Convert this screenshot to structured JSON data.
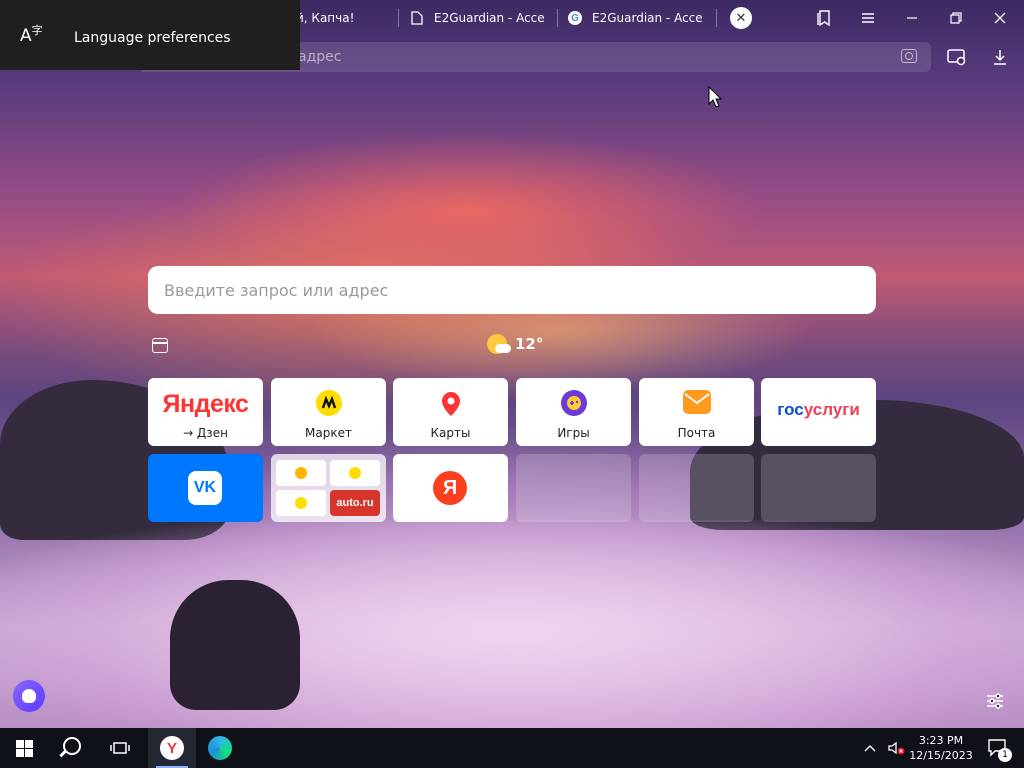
{
  "language_popup": {
    "label": "Language preferences",
    "icon": "language-icon"
  },
  "tabs": [
    {
      "title": "й, Капча!",
      "icon": "captcha-favicon"
    },
    {
      "title": "E2Guardian - Acce",
      "icon": "document-icon"
    },
    {
      "title": "E2Guardian - Acce",
      "icon": "google-icon"
    }
  ],
  "address_bar": {
    "placeholder": "адрес"
  },
  "search": {
    "placeholder": "Введите запрос или адрес"
  },
  "weather": {
    "temperature": "12°"
  },
  "tiles": [
    {
      "name": "yandex",
      "logo_main": "Яндекс",
      "label": "→ Дзен"
    },
    {
      "name": "market",
      "label": "Маркет",
      "icon_color": "#ffdd00"
    },
    {
      "name": "maps",
      "label": "Карты",
      "icon_color": "#f33"
    },
    {
      "name": "games",
      "label": "Игры",
      "icon_color": "#6c3ad9"
    },
    {
      "name": "mail",
      "label": "Почта",
      "icon_color": "#ff9a1d"
    },
    {
      "name": "gosuslugi",
      "logo_a": "гос",
      "logo_b": "услуги"
    },
    {
      "name": "vk",
      "logo": "VK"
    },
    {
      "name": "multi",
      "cell_text": "auto.ru"
    },
    {
      "name": "yandex-red",
      "logo": "Я"
    }
  ],
  "taskbar": {
    "time": "3:23 PM",
    "date": "12/15/2023",
    "notifications": "1"
  },
  "colors": {
    "yandex_red": "#fc3f1d",
    "vk_blue": "#0077ff",
    "gos_blue": "#0d4cd3",
    "gos_red": "#ee3f58"
  }
}
